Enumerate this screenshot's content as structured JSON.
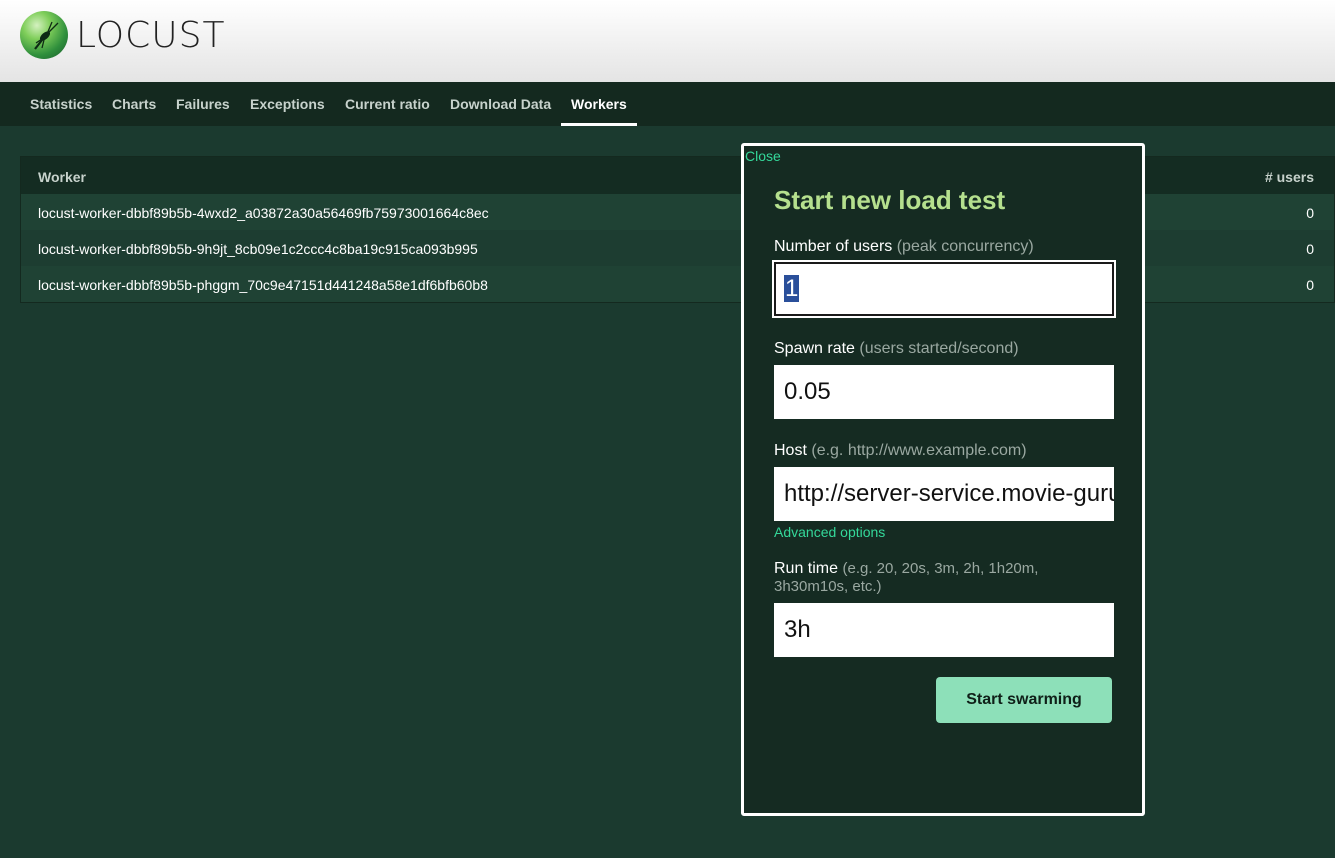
{
  "app": {
    "logo_text": "LOCUST"
  },
  "nav": {
    "items": [
      {
        "label": "Statistics"
      },
      {
        "label": "Charts"
      },
      {
        "label": "Failures"
      },
      {
        "label": "Exceptions"
      },
      {
        "label": "Current ratio"
      },
      {
        "label": "Download Data"
      },
      {
        "label": "Workers",
        "active": true
      }
    ]
  },
  "workers_table": {
    "columns": [
      "Worker",
      "# users"
    ],
    "rows": [
      {
        "worker": "locust-worker-dbbf89b5b-4wxd2_a03872a30a56469fb75973001664c8ec",
        "users": "0"
      },
      {
        "worker": "locust-worker-dbbf89b5b-9h9jt_8cb09e1c2ccc4c8ba19c915ca093b995",
        "users": "0"
      },
      {
        "worker": "locust-worker-dbbf89b5b-phggm_70c9e47151d441248a58e1df6bfb60b8",
        "users": "0"
      }
    ]
  },
  "modal": {
    "close_label": "Close",
    "title": "Start new load test",
    "users": {
      "label": "Number of users",
      "hint": "(peak concurrency)",
      "value": "1"
    },
    "spawn_rate": {
      "label": "Spawn rate",
      "hint": "(users started/second)",
      "value": "0.05"
    },
    "host": {
      "label": "Host",
      "hint": "(e.g. http://www.example.com)",
      "value": "http://server-service.movie-guru"
    },
    "advanced_label": "Advanced options",
    "run_time": {
      "label": "Run time",
      "hint": "(e.g. 20, 20s, 3m, 2h, 1h20m, 3h30m10s, etc.)",
      "value": "3h"
    },
    "submit_label": "Start swarming"
  },
  "colors": {
    "background": "#1b3a2f",
    "navbar": "#14291f",
    "accent_link": "#34d89a",
    "title_green": "#b5e08e",
    "button": "#8de0b9"
  }
}
